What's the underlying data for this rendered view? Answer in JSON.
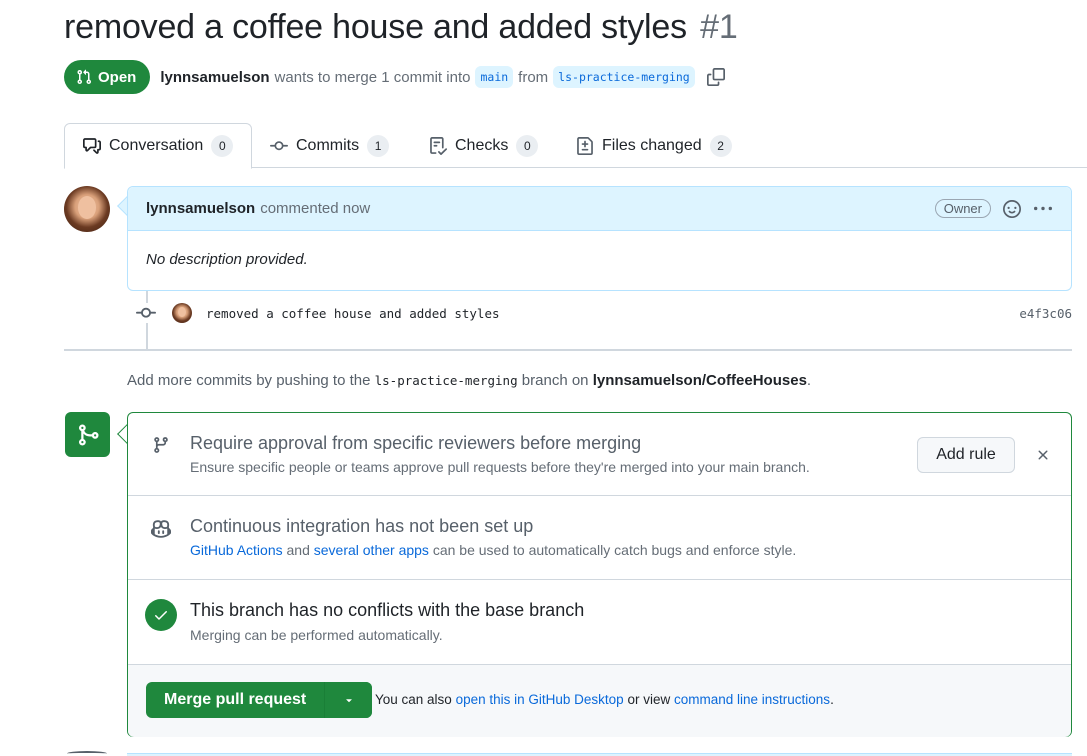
{
  "pr": {
    "title": "removed a coffee house and added styles",
    "number": "#1",
    "state": "Open",
    "author": "lynnsamuelson",
    "merge_text": "wants to merge 1 commit into",
    "base_branch": "main",
    "from_text": "from",
    "head_branch": "ls-practice-merging"
  },
  "tabs": [
    {
      "label": "Conversation",
      "count": "0"
    },
    {
      "label": "Commits",
      "count": "1"
    },
    {
      "label": "Checks",
      "count": "0"
    },
    {
      "label": "Files changed",
      "count": "2"
    }
  ],
  "comment": {
    "author": "lynnsamuelson",
    "action": "commented now",
    "badge": "Owner",
    "body": "No description provided."
  },
  "commit": {
    "message": "removed a coffee house and added styles",
    "sha": "e4f3c06"
  },
  "push_note": {
    "prefix": "Add more commits by pushing to the",
    "branch": "ls-practice-merging",
    "middle": "branch on",
    "repo": "lynnsamuelson/CoffeeHouses",
    "suffix": "."
  },
  "merge_box": {
    "rule": {
      "title": "Require approval from specific reviewers before merging",
      "desc": "Ensure specific people or teams approve pull requests before they're merged into your main branch.",
      "button": "Add rule"
    },
    "ci": {
      "title": "Continuous integration has not been set up",
      "link1": "GitHub Actions",
      "and_text": "and",
      "link2": "several other apps",
      "desc_rest": "can be used to automatically catch bugs and enforce style."
    },
    "conflicts": {
      "title": "This branch has no conflicts with the base branch",
      "desc": "Merging can be performed automatically."
    },
    "footer": {
      "button": "Merge pull request",
      "text1": "You can also",
      "link1": "open this in GitHub Desktop",
      "text2": "or view",
      "link2": "command line instructions",
      "text3": "."
    }
  },
  "colors": {
    "green": "#1f883d",
    "blue_link": "#0969da",
    "comment_header_bg": "#ddf4ff"
  },
  "icons": [
    "pull-request-icon",
    "copy-icon",
    "comment-discussion-icon",
    "git-commit-icon",
    "checklist-icon",
    "file-diff-icon",
    "smiley-icon",
    "kebab-horizontal-icon",
    "git-merge-icon",
    "git-branch-icon",
    "copilot-icon",
    "check-icon",
    "x-icon",
    "triangle-down-icon"
  ]
}
